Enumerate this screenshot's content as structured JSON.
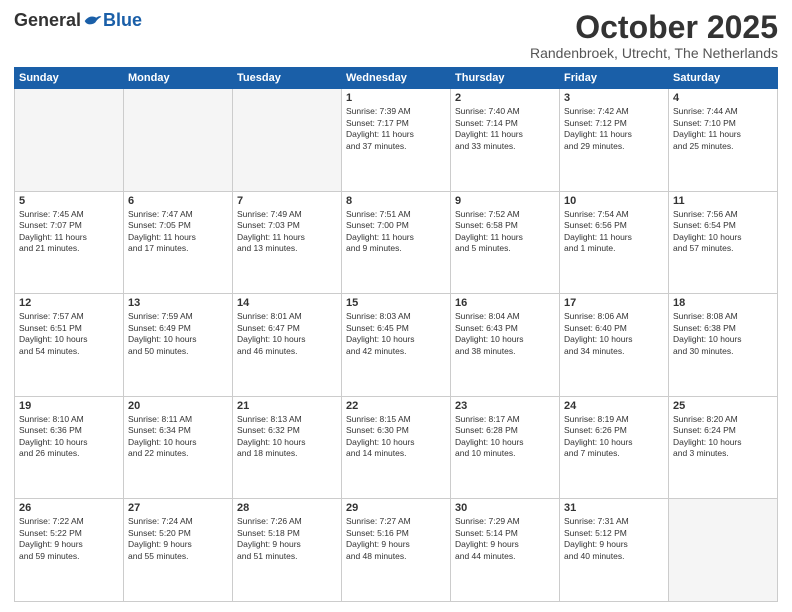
{
  "logo": {
    "general": "General",
    "blue": "Blue"
  },
  "header": {
    "month": "October 2025",
    "location": "Randenbroek, Utrecht, The Netherlands"
  },
  "weekdays": [
    "Sunday",
    "Monday",
    "Tuesday",
    "Wednesday",
    "Thursday",
    "Friday",
    "Saturday"
  ],
  "weeks": [
    [
      {
        "day": "",
        "info": ""
      },
      {
        "day": "",
        "info": ""
      },
      {
        "day": "",
        "info": ""
      },
      {
        "day": "1",
        "info": "Sunrise: 7:39 AM\nSunset: 7:17 PM\nDaylight: 11 hours\nand 37 minutes."
      },
      {
        "day": "2",
        "info": "Sunrise: 7:40 AM\nSunset: 7:14 PM\nDaylight: 11 hours\nand 33 minutes."
      },
      {
        "day": "3",
        "info": "Sunrise: 7:42 AM\nSunset: 7:12 PM\nDaylight: 11 hours\nand 29 minutes."
      },
      {
        "day": "4",
        "info": "Sunrise: 7:44 AM\nSunset: 7:10 PM\nDaylight: 11 hours\nand 25 minutes."
      }
    ],
    [
      {
        "day": "5",
        "info": "Sunrise: 7:45 AM\nSunset: 7:07 PM\nDaylight: 11 hours\nand 21 minutes."
      },
      {
        "day": "6",
        "info": "Sunrise: 7:47 AM\nSunset: 7:05 PM\nDaylight: 11 hours\nand 17 minutes."
      },
      {
        "day": "7",
        "info": "Sunrise: 7:49 AM\nSunset: 7:03 PM\nDaylight: 11 hours\nand 13 minutes."
      },
      {
        "day": "8",
        "info": "Sunrise: 7:51 AM\nSunset: 7:00 PM\nDaylight: 11 hours\nand 9 minutes."
      },
      {
        "day": "9",
        "info": "Sunrise: 7:52 AM\nSunset: 6:58 PM\nDaylight: 11 hours\nand 5 minutes."
      },
      {
        "day": "10",
        "info": "Sunrise: 7:54 AM\nSunset: 6:56 PM\nDaylight: 11 hours\nand 1 minute."
      },
      {
        "day": "11",
        "info": "Sunrise: 7:56 AM\nSunset: 6:54 PM\nDaylight: 10 hours\nand 57 minutes."
      }
    ],
    [
      {
        "day": "12",
        "info": "Sunrise: 7:57 AM\nSunset: 6:51 PM\nDaylight: 10 hours\nand 54 minutes."
      },
      {
        "day": "13",
        "info": "Sunrise: 7:59 AM\nSunset: 6:49 PM\nDaylight: 10 hours\nand 50 minutes."
      },
      {
        "day": "14",
        "info": "Sunrise: 8:01 AM\nSunset: 6:47 PM\nDaylight: 10 hours\nand 46 minutes."
      },
      {
        "day": "15",
        "info": "Sunrise: 8:03 AM\nSunset: 6:45 PM\nDaylight: 10 hours\nand 42 minutes."
      },
      {
        "day": "16",
        "info": "Sunrise: 8:04 AM\nSunset: 6:43 PM\nDaylight: 10 hours\nand 38 minutes."
      },
      {
        "day": "17",
        "info": "Sunrise: 8:06 AM\nSunset: 6:40 PM\nDaylight: 10 hours\nand 34 minutes."
      },
      {
        "day": "18",
        "info": "Sunrise: 8:08 AM\nSunset: 6:38 PM\nDaylight: 10 hours\nand 30 minutes."
      }
    ],
    [
      {
        "day": "19",
        "info": "Sunrise: 8:10 AM\nSunset: 6:36 PM\nDaylight: 10 hours\nand 26 minutes."
      },
      {
        "day": "20",
        "info": "Sunrise: 8:11 AM\nSunset: 6:34 PM\nDaylight: 10 hours\nand 22 minutes."
      },
      {
        "day": "21",
        "info": "Sunrise: 8:13 AM\nSunset: 6:32 PM\nDaylight: 10 hours\nand 18 minutes."
      },
      {
        "day": "22",
        "info": "Sunrise: 8:15 AM\nSunset: 6:30 PM\nDaylight: 10 hours\nand 14 minutes."
      },
      {
        "day": "23",
        "info": "Sunrise: 8:17 AM\nSunset: 6:28 PM\nDaylight: 10 hours\nand 10 minutes."
      },
      {
        "day": "24",
        "info": "Sunrise: 8:19 AM\nSunset: 6:26 PM\nDaylight: 10 hours\nand 7 minutes."
      },
      {
        "day": "25",
        "info": "Sunrise: 8:20 AM\nSunset: 6:24 PM\nDaylight: 10 hours\nand 3 minutes."
      }
    ],
    [
      {
        "day": "26",
        "info": "Sunrise: 7:22 AM\nSunset: 5:22 PM\nDaylight: 9 hours\nand 59 minutes."
      },
      {
        "day": "27",
        "info": "Sunrise: 7:24 AM\nSunset: 5:20 PM\nDaylight: 9 hours\nand 55 minutes."
      },
      {
        "day": "28",
        "info": "Sunrise: 7:26 AM\nSunset: 5:18 PM\nDaylight: 9 hours\nand 51 minutes."
      },
      {
        "day": "29",
        "info": "Sunrise: 7:27 AM\nSunset: 5:16 PM\nDaylight: 9 hours\nand 48 minutes."
      },
      {
        "day": "30",
        "info": "Sunrise: 7:29 AM\nSunset: 5:14 PM\nDaylight: 9 hours\nand 44 minutes."
      },
      {
        "day": "31",
        "info": "Sunrise: 7:31 AM\nSunset: 5:12 PM\nDaylight: 9 hours\nand 40 minutes."
      },
      {
        "day": "",
        "info": ""
      }
    ]
  ]
}
